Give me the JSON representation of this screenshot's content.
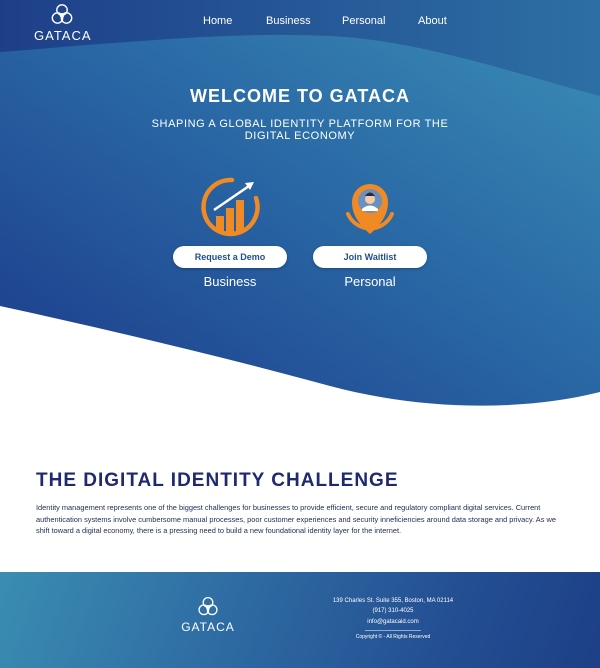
{
  "brand": {
    "name": "GATACA"
  },
  "nav": {
    "items": [
      {
        "label": "Home"
      },
      {
        "label": "Business"
      },
      {
        "label": "Personal"
      },
      {
        "label": "About"
      }
    ]
  },
  "hero": {
    "title": "WELCOME TO GATACA",
    "subtitle": "SHAPING A GLOBAL IDENTITY PLATFORM FOR THE DIGITAL ECONOMY",
    "business": {
      "button": "Request a Demo",
      "label": "Business",
      "icon": "growth-chart-icon"
    },
    "personal": {
      "button": "Join Waitlist",
      "label": "Personal",
      "icon": "user-pin-icon"
    }
  },
  "challenge": {
    "title": "THE DIGITAL IDENTITY CHALLENGE",
    "body": "Identity management represents one of the biggest challenges for businesses to provide efficient, secure and regulatory compliant digital services. Current authentication systems involve cumbersome manual processes, poor customer experiences and security inneficiencies around data storage and privacy. As we shift toward a digital economy, there is a pressing need to build a new foundational identity layer for the internet."
  },
  "footer": {
    "address": "139 Charles St. Suite 355, Boston, MA 02114",
    "phone": "(917) 310-4025",
    "email": "info@gatacaid.com",
    "copyright": "Copyright © - All Rights Reserved"
  },
  "colors": {
    "accent_orange": "#f08a24",
    "brand_navy": "#1f2a6e",
    "hero_blue_dark": "#1c3a8a",
    "hero_blue_light": "#3b8fb6"
  }
}
